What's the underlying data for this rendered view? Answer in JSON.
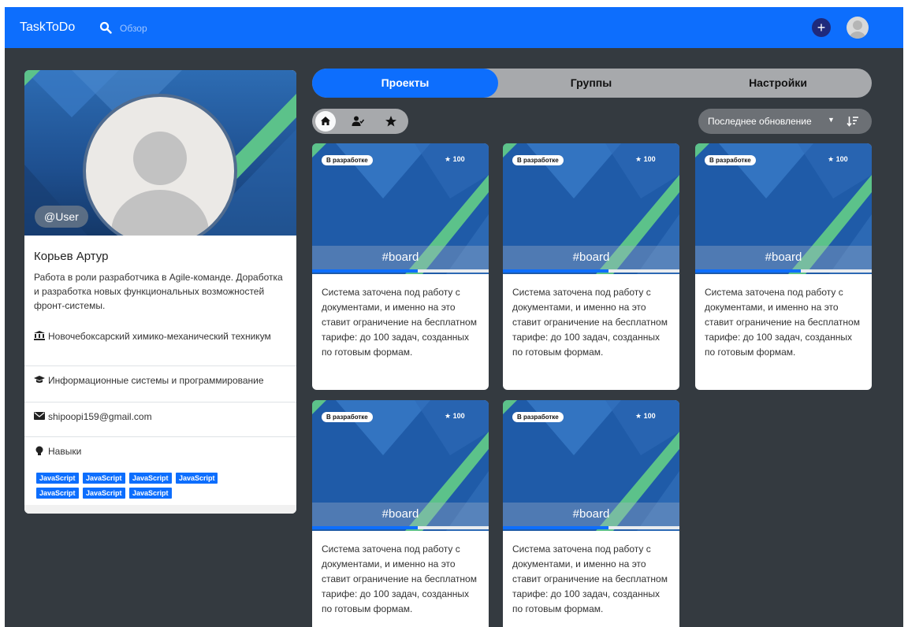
{
  "navbar": {
    "brand": "TaskToDo",
    "search_label": "Обзор",
    "add_icon": "plus-icon",
    "avatar_icon": "user-avatar-icon",
    "accent": "#0d6efd"
  },
  "profile": {
    "username": "@User",
    "name": "Корьев Артур",
    "bio": "Работа в роли разработчика в Agile-команде. Доработка и разработка новых функциональных возможностей фронт-системы.",
    "institution": "Новочебоксарский химико-механический техникум",
    "specialty": "Информационные системы и программирование",
    "email": "shipoopi159@gmail.com",
    "skills_label": "Навыки",
    "skills": [
      "JavaScript",
      "JavaScript",
      "JavaScript",
      "JavaScript",
      "JavaScript",
      "JavaScript",
      "JavaScript"
    ]
  },
  "tabs": [
    {
      "label": "Проекты",
      "active": true
    },
    {
      "label": "Группы",
      "active": false
    },
    {
      "label": "Настройки",
      "active": false
    }
  ],
  "filters": {
    "icons": [
      "home-icon",
      "user-check-icon",
      "star-icon"
    ],
    "active": "home-icon"
  },
  "sort": {
    "label": "Последнее обновление",
    "icon": "sort-descending-icon"
  },
  "projects": [
    {
      "status": "В разработке",
      "stars": "100",
      "tag": "#board",
      "progress": 0.6,
      "description": "Система заточена под работу с документами, и именно на это ставит ограничение на бесплатном тарифе: до 100 задач, созданных по готовым формам."
    },
    {
      "status": "В разработке",
      "stars": "100",
      "tag": "#board",
      "progress": 0.6,
      "description": "Система заточена под работу с документами, и именно на это ставит ограничение на бесплатном тарифе: до 100 задач, созданных по готовым формам."
    },
    {
      "status": "В разработке",
      "stars": "100",
      "tag": "#board",
      "progress": 0.6,
      "description": "Система заточена под работу с документами, и именно на это ставит ограничение на бесплатном тарифе: до 100 задач, созданных по готовым формам."
    },
    {
      "status": "В разработке",
      "stars": "100",
      "tag": "#board",
      "progress": 0.6,
      "description": "Система заточена под работу с документами, и именно на это ставит ограничение на бесплатном тарифе: до 100 задач, созданных по готовым формам."
    },
    {
      "status": "В разработке",
      "stars": "100",
      "tag": "#board",
      "progress": 0.6,
      "description": "Система заточена под работу с документами, и именно на это ставит ограничение на бесплатном тарифе: до 100 задач, созданных по готовым формам."
    }
  ],
  "colors": {
    "background": "#343a40",
    "card_header": "#1f5ba8",
    "accent_green": "#5cc28a",
    "skill_badge": "#0d6efd"
  }
}
